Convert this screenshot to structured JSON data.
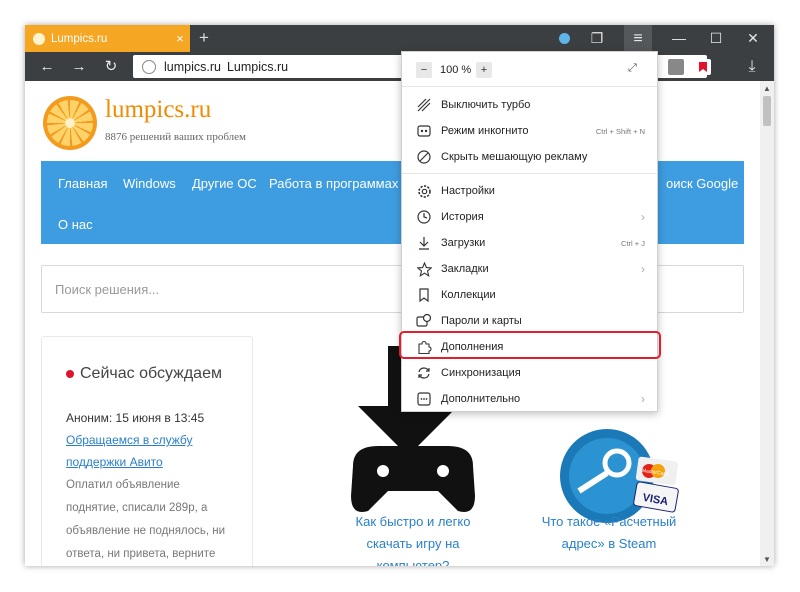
{
  "tab": {
    "title": "Lumpics.ru",
    "close": "×",
    "new": "+"
  },
  "titlebar": {
    "restore": "❐",
    "menu": "≡",
    "minimize": "—",
    "maximize": "☐",
    "close": "✕"
  },
  "nav": {
    "back": "←",
    "forward": "→",
    "reload": "↻",
    "domain": "lumpics.ru",
    "page_title": "Lumpics.ru",
    "download": "⤓"
  },
  "site": {
    "name": "lumpics.ru",
    "tagline": "8876 решений ваших проблем",
    "menu": [
      "Главная",
      "Windows",
      "Другие ОС",
      "Работа в программах",
      "оиск Google",
      "О нас"
    ],
    "search_placeholder": "Поиск решения..."
  },
  "sidebar": {
    "title": "Сейчас обсуждаем",
    "meta": "Аноним: 15 июня в 13:45",
    "link1": "Обращаемся в службу",
    "link2": "поддержки Авито",
    "lines": [
      "Оплатил объявление",
      "поднятие, списали 289р, а",
      "объявление не поднялось, ни",
      "ответа, ни привета, верните"
    ]
  },
  "articles": [
    {
      "caption1": "Как быстро и легко",
      "caption2": "скачать игру на",
      "caption3": "компьютер?"
    },
    {
      "caption1": "Что такое «Расчетный",
      "caption2": "адрес» в Steam",
      "badge1": "MasterCard",
      "badge2": "VISA"
    }
  ],
  "menu": {
    "zoom_minus": "−",
    "zoom_value": "100 %",
    "zoom_plus": "+",
    "fullscreen": "⤢",
    "items": [
      {
        "label": "Выключить турбо",
        "shortcut": ""
      },
      {
        "label": "Режим инкогнито",
        "shortcut": "Ctrl + Shift + N"
      },
      {
        "label": "Скрыть мешающую рекламу",
        "shortcut": ""
      },
      {
        "label": "Настройки",
        "shortcut": ""
      },
      {
        "label": "История",
        "shortcut": ""
      },
      {
        "label": "Загрузки",
        "shortcut": "Ctrl + J"
      },
      {
        "label": "Закладки",
        "shortcut": ""
      },
      {
        "label": "Коллекции",
        "shortcut": ""
      },
      {
        "label": "Пароли и карты",
        "shortcut": ""
      },
      {
        "label": "Дополнения",
        "shortcut": ""
      },
      {
        "label": "Синхронизация",
        "shortcut": ""
      },
      {
        "label": "Дополнительно",
        "shortcut": ""
      }
    ],
    "arrow": "›"
  },
  "colors": {
    "accent": "#3e9ce0",
    "tab": "#f5a623",
    "highlight": "#e01f2e",
    "link": "#2a80c8"
  }
}
